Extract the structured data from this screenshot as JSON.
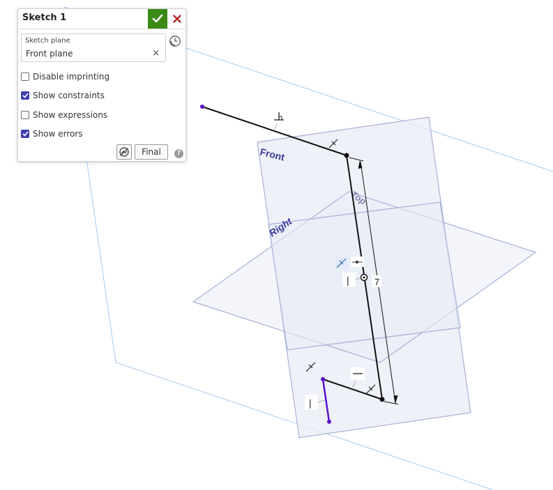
{
  "panel": {
    "title": "Sketch 1",
    "ok_icon": "check-icon",
    "close_icon": "close-icon",
    "sketch_plane": {
      "label": "Sketch plane",
      "value": "Front plane",
      "clear_glyph": "×"
    },
    "history_icon": "clock-icon",
    "options": [
      {
        "label": "Disable imprinting",
        "checked": false
      },
      {
        "label": "Show constraints",
        "checked": true
      },
      {
        "label": "Show expressions",
        "checked": false
      },
      {
        "label": "Show errors",
        "checked": true
      }
    ],
    "display_icon": "sketch-display-icon",
    "final_label": "Final",
    "help_glyph": "?"
  },
  "viewport": {
    "plane_labels": {
      "front": "Front",
      "top": "Top",
      "right": "Right"
    },
    "dimension_value": "7",
    "constraint_glyphs": {
      "vertical": "|",
      "horizontal": "—"
    }
  },
  "colors": {
    "accent": "#3f3fb0",
    "ok_green": "#3a8a16",
    "close_red": "#b5292c",
    "plane_fill": "#e9ecf6",
    "plane_stroke": "#a9b0d6",
    "outline_blue": "#a9c9ee",
    "sketch_purple": "#5a10c8"
  }
}
